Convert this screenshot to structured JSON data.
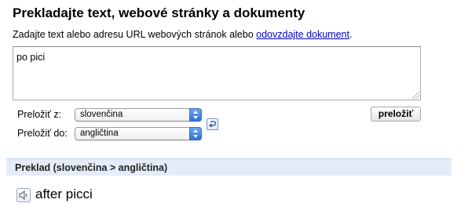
{
  "page": {
    "title": "Prekladajte text, webové stránky a dokumenty",
    "intro_text": "Zadajte text alebo adresu URL webových stránok alebo ",
    "upload_link": "odovzdajte dokument",
    "intro_end": "."
  },
  "source": {
    "value": "po pici"
  },
  "languages": {
    "from_label": "Preložiť z:",
    "from_value": "slovenčina",
    "to_label": "Preložiť do:",
    "to_value": "angličtina",
    "swap_icon": "swap-languages-icon"
  },
  "actions": {
    "translate_label": "preložiť"
  },
  "result": {
    "header": "Preklad (slovenčina > angličtina)",
    "text": "after picci",
    "speaker_icon": "speaker-icon"
  }
}
